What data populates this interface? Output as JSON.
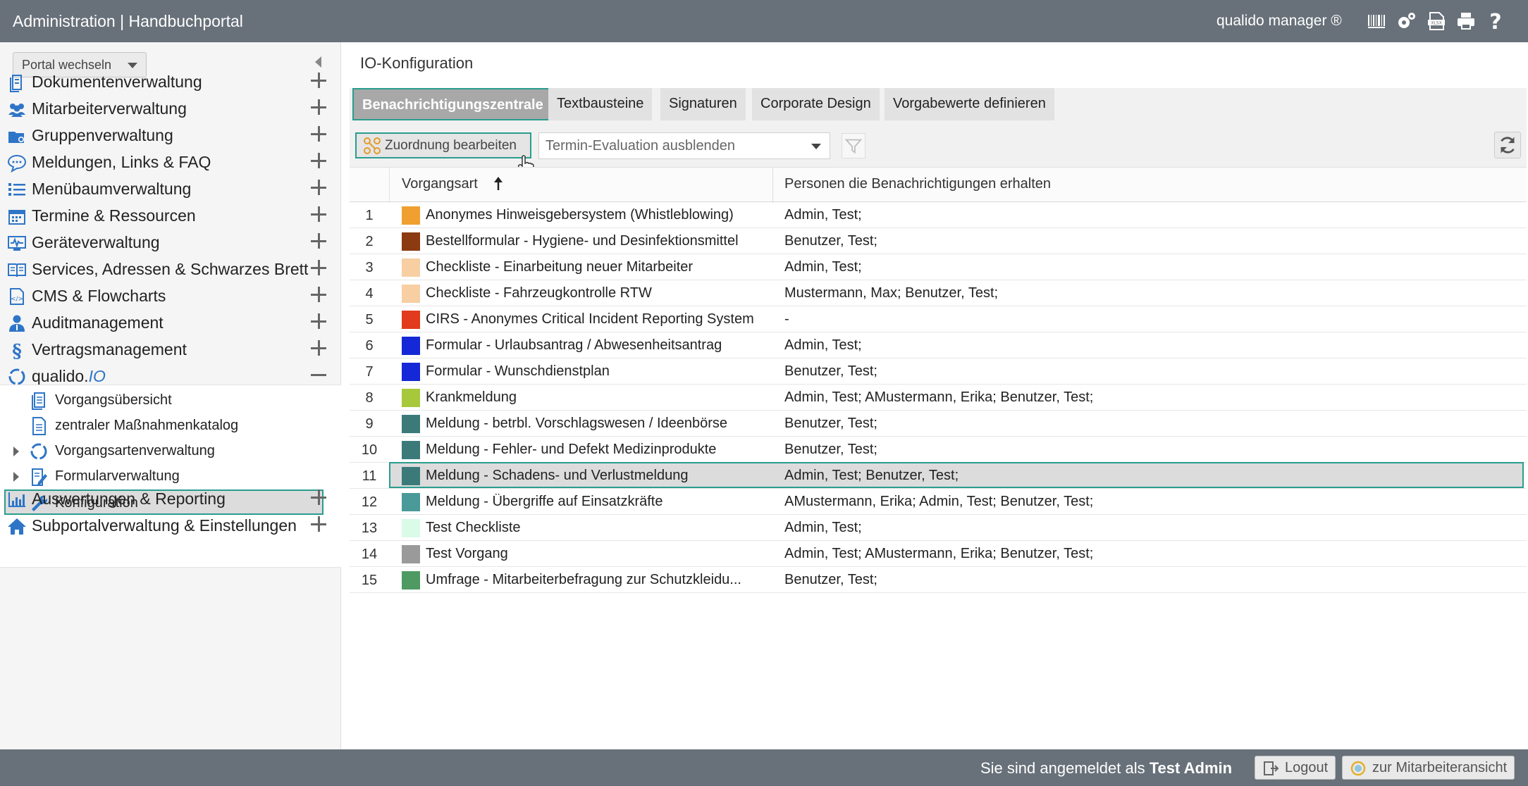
{
  "header": {
    "title": "Administration | Handbuchportal",
    "brand": "qualido manager ®",
    "icons": [
      "barcode-icon",
      "gear-icon",
      "xlsx-icon",
      "print-icon",
      "help-icon"
    ]
  },
  "sidebar": {
    "portal_switch": "Portal wechseln",
    "items": [
      {
        "label": "Dokumentenverwaltung",
        "icon": "document-icon"
      },
      {
        "label": "Mitarbeiterverwaltung",
        "icon": "users-icon"
      },
      {
        "label": "Gruppenverwaltung",
        "icon": "group-icon"
      },
      {
        "label": "Meldungen, Links & FAQ",
        "icon": "chat-icon"
      },
      {
        "label": "Menübaumverwaltung",
        "icon": "list-icon"
      },
      {
        "label": "Termine & Ressourcen",
        "icon": "calendar-icon"
      },
      {
        "label": "Geräteverwaltung",
        "icon": "device-icon"
      },
      {
        "label": "Services, Adressen & Schwarzes Brett",
        "icon": "book-icon"
      },
      {
        "label": "CMS & Flowcharts",
        "icon": "cms-icon"
      },
      {
        "label": "Auditmanagement",
        "icon": "auditor-icon"
      },
      {
        "label": "Vertragsmanagement",
        "icon": "paragraph-icon"
      },
      {
        "label_prefix": "qualido.",
        "label_suffix": "IO",
        "icon": "qualido-io-icon"
      },
      {
        "label": "Auswertungen & Reporting",
        "icon": "chart-icon"
      },
      {
        "label": "Subportalverwaltung & Einstellungen",
        "icon": "home-icon"
      }
    ],
    "subitems": [
      {
        "label": "Vorgangsübersicht",
        "icon": "document-stack-icon"
      },
      {
        "label": "zentraler Maßnahmenkatalog",
        "icon": "catalog-icon"
      },
      {
        "label": "Vorgangsartenverwaltung",
        "icon": "cycle-icon"
      },
      {
        "label": "Formularverwaltung",
        "icon": "form-edit-icon"
      },
      {
        "label": "Konfiguration",
        "icon": "wrench-icon"
      }
    ]
  },
  "main": {
    "title": "IO-Konfiguration",
    "tabs": [
      "Benachrichtigungszentrale",
      "Textbausteine",
      "Signaturen",
      "Corporate Design",
      "Vorgabewerte definieren"
    ],
    "toolbar": {
      "edit_button": "Zuordnung bearbeiten",
      "select_value": "Termin-Evaluation ausblenden"
    },
    "table": {
      "col_type": "Vorgangsart",
      "col_persons": "Personen die Benachrichtigungen erhalten",
      "rows": [
        {
          "num": "1",
          "color": "#f0a030",
          "name": "Anonymes Hinweisgebersystem (Whistleblowing)",
          "persons": "Admin, Test;"
        },
        {
          "num": "2",
          "color": "#8b3a12",
          "name": "Bestellformular - Hygiene- und Desinfektionsmittel",
          "persons": "Benutzer, Test;"
        },
        {
          "num": "3",
          "color": "#f7cfa3",
          "name": "Checkliste - Einarbeitung neuer Mitarbeiter",
          "persons": "Admin, Test;"
        },
        {
          "num": "4",
          "color": "#f7cfa3",
          "name": "Checkliste - Fahrzeugkontrolle RTW",
          "persons": "Mustermann, Max; Benutzer, Test;"
        },
        {
          "num": "5",
          "color": "#e23a1c",
          "name": "CIRS - Anonymes Critical Incident Reporting System",
          "persons": "-"
        },
        {
          "num": "6",
          "color": "#1428d8",
          "name": "Formular - Urlaubsantrag / Abwesenheitsantrag",
          "persons": "Admin, Test;"
        },
        {
          "num": "7",
          "color": "#1428d8",
          "name": "Formular - Wunschdienstplan",
          "persons": "Benutzer, Test;"
        },
        {
          "num": "8",
          "color": "#a6c83a",
          "name": "Krankmeldung",
          "persons": "Admin, Test; AMustermann, Erika; Benutzer, Test;"
        },
        {
          "num": "9",
          "color": "#3c7a7a",
          "name": "Meldung - betrbl. Vorschlagswesen / Ideenbörse",
          "persons": "Benutzer, Test;"
        },
        {
          "num": "10",
          "color": "#3c7a7a",
          "name": "Meldung - Fehler- und Defekt Medizinprodukte",
          "persons": "Benutzer, Test;"
        },
        {
          "num": "11",
          "color": "#3c7a7a",
          "name": "Meldung - Schadens- und Verlustmeldung",
          "persons": "Admin, Test; Benutzer, Test;"
        },
        {
          "num": "12",
          "color": "#4a9a9a",
          "name": "Meldung - Übergriffe auf Einsatzkräfte",
          "persons": "AMustermann, Erika; Admin, Test; Benutzer, Test;"
        },
        {
          "num": "13",
          "color": "#d9fbe8",
          "name": "Test Checkliste",
          "persons": "Admin, Test;"
        },
        {
          "num": "14",
          "color": "#9a9a9a",
          "name": "Test Vorgang",
          "persons": "Admin, Test; AMustermann, Erika; Benutzer, Test;"
        },
        {
          "num": "15",
          "color": "#4e9a62",
          "name": "Umfrage - Mitarbeiterbefragung zur Schutzkleidu...",
          "persons": "Benutzer, Test;"
        }
      ]
    }
  },
  "footer": {
    "logged_in_prefix": "Sie sind angemeldet als",
    "user": "Test Admin",
    "logout": "Logout",
    "employee_view": "zur Mitarbeiteransicht"
  },
  "colors": {
    "header_bg": "#687079",
    "highlight": "#2a9d8f",
    "accent_blue": "#2e75c7"
  }
}
